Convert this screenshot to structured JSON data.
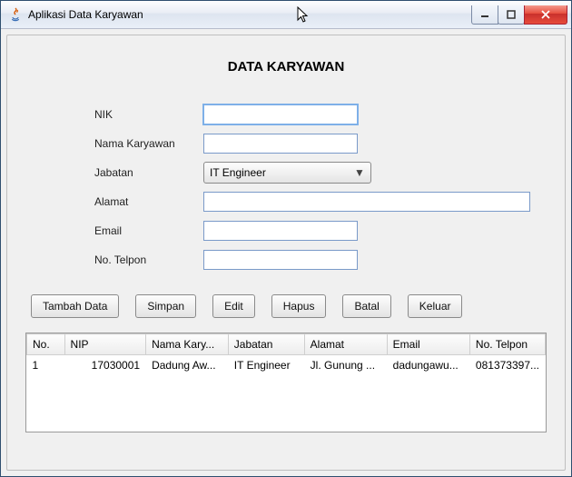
{
  "window": {
    "title": "Aplikasi Data Karyawan"
  },
  "page": {
    "title": "DATA KARYAWAN"
  },
  "form": {
    "nik": {
      "label": "NIK",
      "value": ""
    },
    "nama": {
      "label": "Nama Karyawan",
      "value": ""
    },
    "jabatan": {
      "label": "Jabatan",
      "value": "IT Engineer"
    },
    "alamat": {
      "label": "Alamat",
      "value": ""
    },
    "email": {
      "label": "Email",
      "value": ""
    },
    "telpon": {
      "label": "No. Telpon",
      "value": ""
    }
  },
  "buttons": {
    "tambah": "Tambah Data",
    "simpan": "Simpan",
    "edit": "Edit",
    "hapus": "Hapus",
    "batal": "Batal",
    "keluar": "Keluar"
  },
  "table": {
    "headers": {
      "no": "No.",
      "nip": "NIP",
      "nama": "Nama Kary...",
      "jabatan": "Jabatan",
      "alamat": "Alamat",
      "email": "Email",
      "telpon": "No. Telpon"
    },
    "rows": [
      {
        "no": "1",
        "nip": "17030001",
        "nama": "Dadung Aw...",
        "jabatan": "IT Engineer",
        "alamat": "Jl. Gunung ...",
        "email": "dadungawu...",
        "telpon": "081373397..."
      }
    ]
  }
}
